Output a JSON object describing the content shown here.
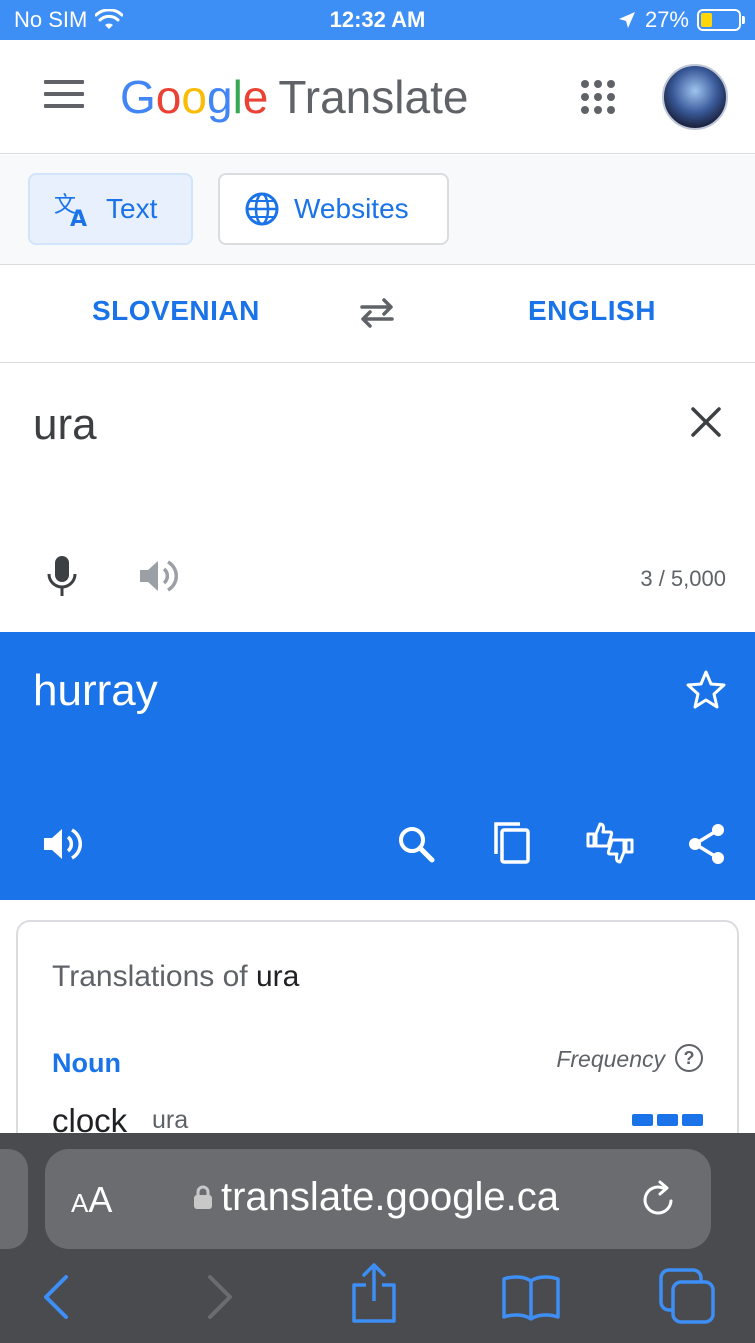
{
  "status_bar": {
    "carrier": "No SIM",
    "time": "12:32 AM",
    "battery": "27%"
  },
  "header": {
    "logo_letters": [
      "G",
      "o",
      "o",
      "g",
      "l",
      "e"
    ],
    "product": "Translate"
  },
  "modes": {
    "text_label": "Text",
    "websites_label": "Websites"
  },
  "languages": {
    "source": "SLOVENIAN",
    "target": "ENGLISH"
  },
  "source": {
    "text": "ura",
    "char_count": "3 / 5,000"
  },
  "target": {
    "text": "hurray"
  },
  "translations_card": {
    "title_prefix": "Translations of",
    "title_word": "ura",
    "part_of_speech": "Noun",
    "frequency_label": "Frequency",
    "help_glyph": "?",
    "entries": [
      {
        "word": "clock",
        "back_translation": "ura",
        "frequency_level": 3
      }
    ]
  },
  "browser": {
    "text_size_small": "A",
    "text_size_large": "A",
    "url": "translate.google.ca"
  },
  "colors": {
    "accent": "#1a73e8",
    "status_bar": "#3d8ef5",
    "safari_bar": "#4a4b4e"
  }
}
